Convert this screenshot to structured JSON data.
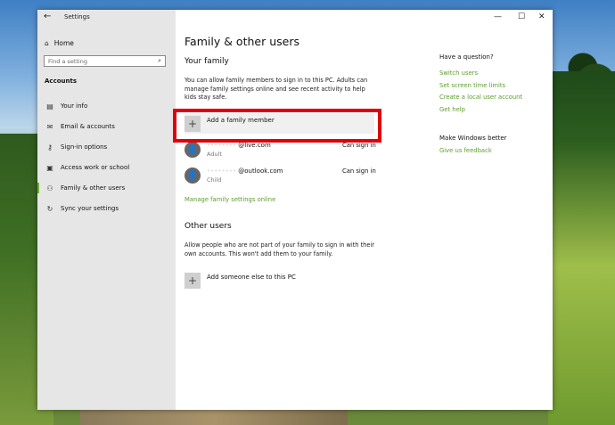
{
  "window": {
    "title": "Settings",
    "controls": {
      "minimize": "—",
      "maximize": "☐",
      "close": "✕"
    }
  },
  "sidebar": {
    "home_label": "Home",
    "search_placeholder": "Find a setting",
    "section_label": "Accounts",
    "items": [
      {
        "label": "Your info",
        "icon": "user-card-icon"
      },
      {
        "label": "Email & accounts",
        "icon": "mail-icon"
      },
      {
        "label": "Sign-in options",
        "icon": "key-icon"
      },
      {
        "label": "Access work or school",
        "icon": "briefcase-icon"
      },
      {
        "label": "Family & other users",
        "icon": "people-icon",
        "active": true
      },
      {
        "label": "Sync your settings",
        "icon": "sync-icon"
      }
    ]
  },
  "main": {
    "title": "Family & other users",
    "family": {
      "heading": "Your family",
      "description": "You can allow family members to sign in to this PC. Adults can manage family settings online and see recent activity to help kids stay safe.",
      "add_label": "Add a family member",
      "members": [
        {
          "name_hidden": "••••••••",
          "name_domain": "@live.com",
          "role": "Adult",
          "status": "Can sign in"
        },
        {
          "name_hidden": "••••••••",
          "name_domain": "@outlook.com",
          "role": "Child",
          "status": "Can sign in"
        }
      ],
      "manage_link": "Manage family settings online"
    },
    "other": {
      "heading": "Other users",
      "description": "Allow people who are not part of your family to sign in with their own accounts. This won't add them to your family.",
      "add_label": "Add someone else to this PC"
    }
  },
  "right": {
    "question_heading": "Have a question?",
    "links": [
      "Switch users",
      "Set screen time limits",
      "Create a local user account",
      "Get help"
    ],
    "better_heading": "Make Windows better",
    "feedback_link": "Give us feedback"
  },
  "colors": {
    "accent_link": "#5c9c2b",
    "highlight_frame": "#e0000a",
    "sidebar_bg": "#e6e6e6"
  }
}
